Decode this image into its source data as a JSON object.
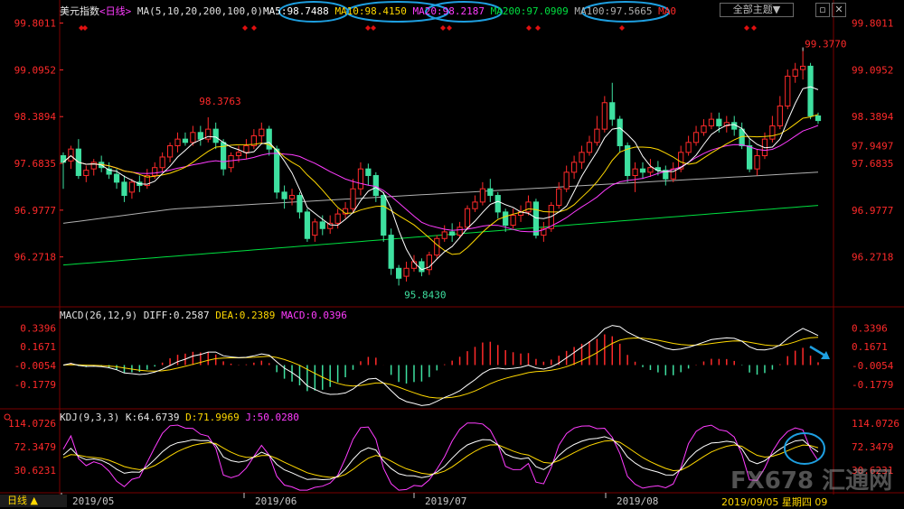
{
  "header": {
    "title": "美元指数",
    "period": "<日线>",
    "ma_params": "MA(5,10,20,200,100,0)",
    "ma_values": [
      {
        "label": "MA5:98.7488",
        "color": "#ffffff"
      },
      {
        "label": "MA10:98.4150",
        "color": "#ffd800"
      },
      {
        "label": "MA20:98.2187",
        "color": "#ff3cff"
      },
      {
        "label": "MA200:97.0909",
        "color": "#00e040"
      },
      {
        "label": "MA100:97.5665",
        "color": "#b0b0b0"
      },
      {
        "label": "MA0",
        "color": "#ff2a2a"
      }
    ],
    "theme_button": "全部主题▼"
  },
  "macd": {
    "title": "MACD(26,12,9)",
    "diff": "DIFF:0.2587",
    "dea": "DEA:0.2389",
    "macd": "MACD:0.0396"
  },
  "kdj": {
    "title": "KDJ(9,3,3)",
    "k": "K:64.6739",
    "d": "D:71.9969",
    "j": "J:50.0280"
  },
  "footer": {
    "tab": "日线 ▲",
    "date_tag": "2019/09/05 星期四 09",
    "watermark": "FX678 汇通网"
  },
  "colors": {
    "up": "#ff2a2a",
    "down": "#3ee0a0",
    "ma5": "#ffffff",
    "ma10": "#ffd800",
    "ma20": "#ff3cff",
    "ma100": "#b0b0b0",
    "ma200": "#00e040",
    "annotation": "#1e9fe0"
  },
  "chart_data": {
    "type": "candlestick",
    "x_ticks": [
      "2019/05",
      "2019/06",
      "2019/07",
      "2019/08"
    ],
    "price_axis": [
      "99.8011",
      "99.0952",
      "98.3894",
      "97.6835",
      "96.9777",
      "96.2718"
    ],
    "price_axis_right_extra": "97.9497",
    "ylim": [
      95.6,
      99.85
    ],
    "annotations": {
      "high": "99.3770",
      "low": "95.8430",
      "mid_high": "98.3763"
    },
    "macd_axis": [
      "0.3396",
      "0.1671",
      "-0.0054",
      "-0.1779"
    ],
    "macd_ylim": [
      -0.26,
      0.4
    ],
    "kdj_axis": [
      "114.0726",
      "72.3479",
      "30.6231"
    ],
    "kdj_ylim": [
      0,
      125
    ],
    "candles": [
      [
        97.8,
        97.7,
        97.85,
        97.3
      ],
      [
        97.72,
        97.9,
        97.95,
        97.6
      ],
      [
        97.9,
        97.5,
        98.05,
        97.45
      ],
      [
        97.5,
        97.58,
        97.65,
        97.4
      ],
      [
        97.6,
        97.7,
        97.75,
        97.5
      ],
      [
        97.7,
        97.62,
        97.8,
        97.55
      ],
      [
        97.6,
        97.52,
        97.7,
        97.45
      ],
      [
        97.52,
        97.4,
        97.6,
        97.3
      ],
      [
        97.4,
        97.2,
        97.5,
        97.1
      ],
      [
        97.25,
        97.4,
        97.45,
        97.15
      ],
      [
        97.4,
        97.35,
        97.5,
        97.25
      ],
      [
        97.35,
        97.5,
        97.6,
        97.3
      ],
      [
        97.5,
        97.62,
        97.7,
        97.45
      ],
      [
        97.62,
        97.78,
        97.85,
        97.55
      ],
      [
        97.78,
        97.95,
        98.0,
        97.7
      ],
      [
        97.95,
        98.05,
        98.15,
        97.85
      ],
      [
        98.05,
        98.0,
        98.15,
        97.95
      ],
      [
        98.0,
        98.15,
        98.25,
        97.95
      ],
      [
        98.15,
        98.05,
        98.25,
        97.95
      ],
      [
        98.05,
        98.2,
        98.38,
        98.0
      ],
      [
        98.2,
        98.0,
        98.3,
        97.9
      ],
      [
        98.0,
        97.6,
        98.05,
        97.5
      ],
      [
        97.62,
        97.8,
        97.85,
        97.55
      ],
      [
        97.8,
        97.85,
        97.95,
        97.7
      ],
      [
        97.85,
        97.95,
        98.05,
        97.75
      ],
      [
        97.95,
        98.1,
        98.2,
        97.9
      ],
      [
        98.1,
        98.2,
        98.3,
        98.0
      ],
      [
        98.2,
        97.9,
        98.25,
        97.8
      ],
      [
        97.9,
        97.25,
        97.95,
        97.15
      ],
      [
        97.25,
        97.15,
        97.35,
        97.0
      ],
      [
        97.15,
        97.2,
        97.3,
        97.05
      ],
      [
        97.2,
        96.95,
        97.25,
        96.85
      ],
      [
        96.95,
        96.55,
        97.0,
        96.5
      ],
      [
        96.6,
        96.8,
        96.85,
        96.5
      ],
      [
        96.8,
        96.7,
        96.9,
        96.6
      ],
      [
        96.7,
        96.78,
        96.9,
        96.62
      ],
      [
        96.78,
        96.92,
        97.0,
        96.7
      ],
      [
        96.92,
        97.0,
        97.1,
        96.85
      ],
      [
        97.0,
        97.3,
        97.45,
        96.95
      ],
      [
        97.3,
        97.6,
        97.7,
        97.2
      ],
      [
        97.6,
        97.5,
        97.68,
        97.35
      ],
      [
        97.5,
        97.2,
        97.55,
        97.1
      ],
      [
        97.2,
        96.6,
        97.25,
        96.5
      ],
      [
        96.6,
        96.1,
        96.7,
        96.0
      ],
      [
        96.1,
        95.95,
        96.15,
        95.84
      ],
      [
        95.98,
        96.1,
        96.2,
        95.9
      ],
      [
        96.1,
        96.2,
        96.3,
        96.05
      ],
      [
        96.2,
        96.05,
        96.25,
        95.98
      ],
      [
        96.08,
        96.3,
        96.35,
        96.0
      ],
      [
        96.3,
        96.55,
        96.6,
        96.25
      ],
      [
        96.55,
        96.65,
        96.75,
        96.5
      ],
      [
        96.65,
        96.6,
        96.78,
        96.5
      ],
      [
        96.6,
        96.72,
        96.8,
        96.55
      ],
      [
        96.72,
        97.0,
        97.05,
        96.68
      ],
      [
        97.0,
        97.1,
        97.2,
        96.95
      ],
      [
        97.1,
        97.3,
        97.4,
        97.05
      ],
      [
        97.3,
        97.2,
        97.45,
        97.1
      ],
      [
        97.2,
        96.95,
        97.25,
        96.85
      ],
      [
        96.95,
        96.75,
        97.0,
        96.65
      ],
      [
        96.75,
        96.9,
        97.0,
        96.7
      ],
      [
        96.9,
        96.95,
        97.05,
        96.8
      ],
      [
        96.95,
        97.1,
        97.2,
        96.9
      ],
      [
        97.1,
        96.6,
        97.15,
        96.55
      ],
      [
        96.6,
        96.7,
        96.8,
        96.5
      ],
      [
        96.7,
        97.05,
        97.1,
        96.65
      ],
      [
        97.05,
        97.3,
        97.4,
        97.0
      ],
      [
        97.3,
        97.55,
        97.65,
        97.25
      ],
      [
        97.55,
        97.7,
        97.8,
        97.45
      ],
      [
        97.7,
        97.85,
        97.95,
        97.6
      ],
      [
        97.85,
        98.0,
        98.1,
        97.8
      ],
      [
        98.0,
        98.2,
        98.4,
        97.95
      ],
      [
        98.2,
        98.6,
        98.7,
        98.15
      ],
      [
        98.6,
        98.35,
        98.9,
        98.25
      ],
      [
        98.35,
        97.95,
        98.4,
        97.85
      ],
      [
        97.95,
        97.5,
        98.0,
        97.4
      ],
      [
        97.5,
        97.6,
        97.7,
        97.25
      ],
      [
        97.6,
        97.55,
        97.7,
        97.45
      ],
      [
        97.55,
        97.62,
        97.75,
        97.48
      ],
      [
        97.62,
        97.58,
        97.72,
        97.5
      ],
      [
        97.58,
        97.45,
        97.65,
        97.35
      ],
      [
        97.45,
        97.6,
        97.7,
        97.4
      ],
      [
        97.6,
        97.85,
        97.95,
        97.55
      ],
      [
        97.85,
        98.0,
        98.1,
        97.8
      ],
      [
        98.0,
        98.15,
        98.25,
        97.95
      ],
      [
        98.15,
        98.25,
        98.35,
        98.1
      ],
      [
        98.25,
        98.35,
        98.45,
        98.2
      ],
      [
        98.35,
        98.25,
        98.45,
        98.15
      ],
      [
        98.25,
        98.3,
        98.4,
        98.15
      ],
      [
        98.3,
        98.2,
        98.4,
        98.1
      ],
      [
        98.2,
        97.95,
        98.3,
        97.9
      ],
      [
        97.95,
        97.6,
        98.05,
        97.55
      ],
      [
        97.6,
        97.8,
        97.9,
        97.5
      ],
      [
        97.8,
        98.05,
        98.15,
        97.75
      ],
      [
        98.05,
        98.25,
        98.4,
        98.0
      ],
      [
        98.25,
        98.55,
        98.7,
        98.2
      ],
      [
        98.55,
        99.0,
        99.1,
        98.5
      ],
      [
        99.0,
        99.1,
        99.2,
        98.9
      ],
      [
        99.1,
        99.15,
        99.38,
        98.95
      ],
      [
        99.15,
        98.4,
        99.2,
        98.35
      ],
      [
        98.4,
        98.33,
        98.45,
        98.28
      ]
    ]
  }
}
